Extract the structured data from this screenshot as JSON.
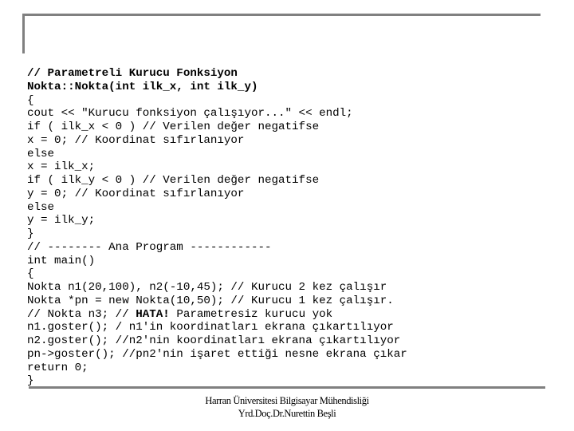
{
  "slide": {
    "code_lines": [
      {
        "segments": [
          {
            "text": "// Parametreli Kurucu Fonksiyon",
            "bold": true
          }
        ]
      },
      {
        "segments": [
          {
            "text": "Nokta::Nokta(int ilk_x, int ilk_y)",
            "bold": true
          }
        ]
      },
      {
        "segments": [
          {
            "text": "{",
            "bold": false
          }
        ]
      },
      {
        "segments": [
          {
            "text": "cout << \"Kurucu fonksiyon çalışıyor...\" << endl;",
            "bold": false
          }
        ]
      },
      {
        "segments": [
          {
            "text": "if ( ilk_x < 0 ) // Verilen değer negatifse",
            "bold": false
          }
        ]
      },
      {
        "segments": [
          {
            "text": "x = 0; // Koordinat sıfırlanıyor",
            "bold": false
          }
        ]
      },
      {
        "segments": [
          {
            "text": "else",
            "bold": false
          }
        ]
      },
      {
        "segments": [
          {
            "text": "x = ilk_x;",
            "bold": false
          }
        ]
      },
      {
        "segments": [
          {
            "text": "if ( ilk_y < 0 ) // Verilen değer negatifse",
            "bold": false
          }
        ]
      },
      {
        "segments": [
          {
            "text": "y = 0; // Koordinat sıfırlanıyor",
            "bold": false
          }
        ]
      },
      {
        "segments": [
          {
            "text": "else",
            "bold": false
          }
        ]
      },
      {
        "segments": [
          {
            "text": "y = ilk_y;",
            "bold": false
          }
        ]
      },
      {
        "segments": [
          {
            "text": "}",
            "bold": false
          }
        ]
      },
      {
        "segments": [
          {
            "text": "// -------- Ana Program ------------",
            "bold": false
          }
        ]
      },
      {
        "segments": [
          {
            "text": "int main()",
            "bold": false
          }
        ]
      },
      {
        "segments": [
          {
            "text": "{",
            "bold": false
          }
        ]
      },
      {
        "segments": [
          {
            "text": "Nokta n1(20,100), n2(-10,45); // Kurucu 2 kez çalışır",
            "bold": false
          }
        ]
      },
      {
        "segments": [
          {
            "text": "Nokta *pn = new Nokta(10,50); // Kurucu 1 kez çalışır.",
            "bold": false
          }
        ]
      },
      {
        "segments": [
          {
            "text": "// Nokta n3; // ",
            "bold": false
          },
          {
            "text": "HATA!",
            "bold": true
          },
          {
            "text": " Parametresiz kurucu yok",
            "bold": false
          }
        ]
      },
      {
        "segments": [
          {
            "text": "n1.goster(); / n1'in koordinatları ekrana çıkartılıyor",
            "bold": false
          }
        ]
      },
      {
        "segments": [
          {
            "text": "n2.goster(); //n2'nin koordinatları ekrana çıkartılıyor",
            "bold": false
          }
        ]
      },
      {
        "segments": [
          {
            "text": "pn->goster(); //pn2'nin işaret ettiği nesne ekrana çıkar",
            "bold": false
          }
        ]
      },
      {
        "segments": [
          {
            "text": "return 0;",
            "bold": false
          }
        ]
      },
      {
        "segments": [
          {
            "text": "}",
            "bold": false
          }
        ]
      }
    ],
    "footer": {
      "line1": "Harran Üniversitesi Bilgisayar Mühendisliği",
      "line2": "Yrd.Doç.Dr.Nurettin Beşli"
    },
    "colors": {
      "frame": "#808080",
      "text": "#000000",
      "background": "#ffffff"
    }
  }
}
